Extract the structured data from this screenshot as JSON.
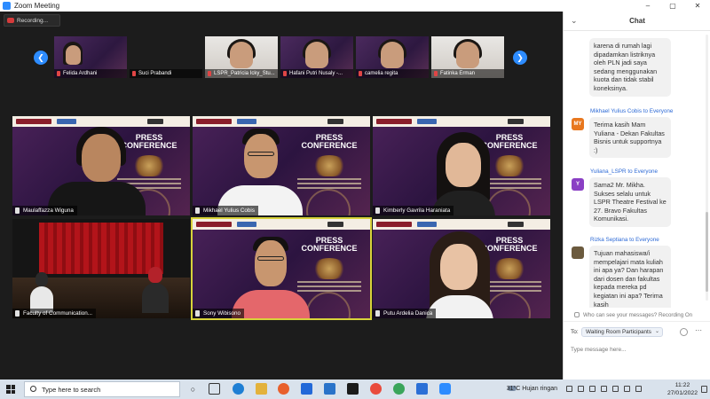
{
  "window": {
    "title": "Zoom Meeting",
    "controls": [
      "–",
      "▢",
      "✕"
    ]
  },
  "recording": {
    "label": "Recording..."
  },
  "strip": {
    "participants": [
      {
        "name": "Felida Ardhani",
        "bg": "poster"
      },
      {
        "name": "Suci Prabandi",
        "bg": "dark"
      },
      {
        "name": "LSPR_Patricia Icky_Stu...",
        "bg": "room"
      },
      {
        "name": "Hafani Putri Nusaly -...",
        "bg": "poster"
      },
      {
        "name": "camelia regita",
        "bg": "poster"
      },
      {
        "name": "Fatinka Erman",
        "bg": "room"
      }
    ]
  },
  "poster_title": "PRESS CONFERENCE",
  "grid": [
    {
      "name": "Maulaffazza Wiguna",
      "type": "poster-person-left"
    },
    {
      "name": "Mikhael Yulius Cobis",
      "type": "poster-man"
    },
    {
      "name": "Kimberly Gavrila Haraniata",
      "type": "poster-girl"
    },
    {
      "name": "Faculty of Communication...",
      "type": "stage"
    },
    {
      "name": "Sony Wibisono",
      "type": "poster-man2",
      "active": true
    },
    {
      "name": "Putu Ardelia Danica",
      "type": "poster-girl2"
    }
  ],
  "chat": {
    "title": "Chat",
    "messages": [
      {
        "sender": "",
        "to": "",
        "avatar": "",
        "avatar_color": "",
        "text": "karena di rumah lagi dipadamkan listriknya oleh PLN jadi saya sedang menggunakan kuota dan tidak stabil koneksinya."
      },
      {
        "sender": "Mikhael Yulius Cobis",
        "to": "to Everyone",
        "avatar": "MY",
        "avatar_color": "#e8771e",
        "text": "Terima kasih Mam Yuliana - Dekan Fakultas Bisnis untuk supportnya :)"
      },
      {
        "sender": "Yuliana_LSPR",
        "to": "to Everyone",
        "avatar": "Y",
        "avatar_color": "#8a3fc4",
        "text": "Sama2 Mr. Mikha. Sukses selalu untuk LSPR Theatre Festival ke 27. Bravo Fakultas Komunikasi."
      },
      {
        "sender": "Rizka Septiana",
        "to": "to Everyone",
        "avatar": "",
        "avatar_color": "#6b5a3e",
        "text": "Tujuan mahasiswa/i mempelajari mata kuliah ini apa ya? Dan harapan dari dosen dan fakultas kepada mereka pd kegiatan ini apa? Terima kasih"
      }
    ],
    "who_can_see": "Who can see your messages? Recording On",
    "to_label": "To:",
    "to_value": "Waiting Room Participants",
    "input_placeholder": "Type message here..."
  },
  "taskbar": {
    "search_placeholder": "Type here to search",
    "weather": "31°C  Hujan ringan",
    "time": "11:22",
    "date": "27/01/2022"
  }
}
